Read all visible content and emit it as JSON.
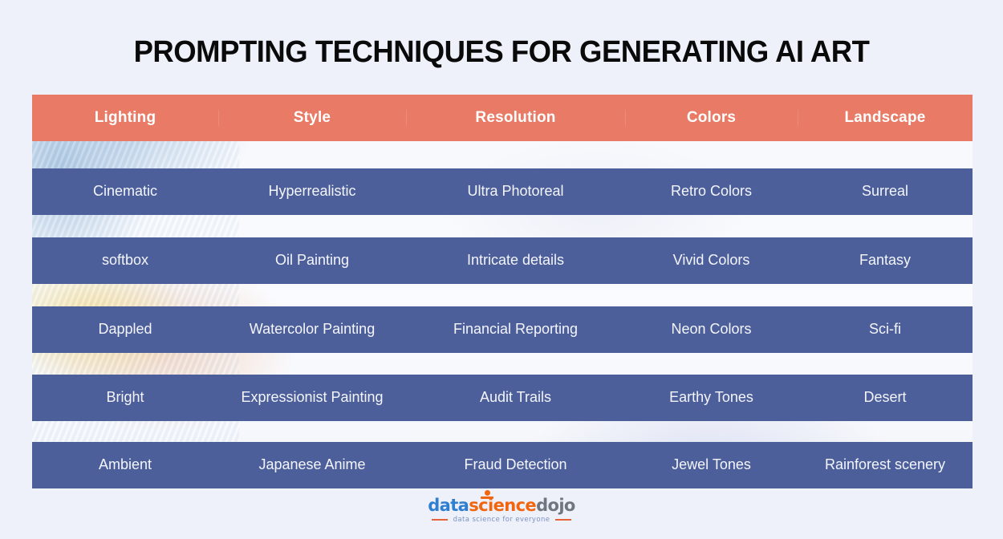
{
  "page": {
    "title": "PROMPTING TECHNIQUES FOR GENERATING AI ART",
    "background_color": "#EEF0FA"
  },
  "colors": {
    "header_background": "#E87A66",
    "row_background": "#4C5F9B",
    "header_text": "#FFFFFF",
    "row_text": "#F4F5FA",
    "title_text": "#0A0A0A",
    "logo_blue": "#2F7FD1",
    "logo_orange": "#F2650F",
    "logo_gray": "#6F7680",
    "tagline_text": "#7D93C4"
  },
  "table": {
    "headers": [
      "Lighting",
      "Style",
      "Resolution",
      "Colors",
      "Landscape"
    ],
    "rows": [
      [
        "Cinematic",
        "Hyperrealistic",
        "Ultra Photoreal",
        "Retro Colors",
        "Surreal"
      ],
      [
        "softbox",
        "Oil Painting",
        "Intricate details",
        "Vivid Colors",
        "Fantasy"
      ],
      [
        "Dappled",
        "Watercolor Painting",
        "Financial Reporting",
        "Neon Colors",
        "Sci-fi"
      ],
      [
        "Bright",
        "Expressionist Painting",
        "Audit Trails",
        "Earthy Tones",
        "Desert"
      ],
      [
        "Ambient",
        "Japanese Anime",
        "Fraud Detection",
        "Jewel Tones",
        "Rainforest scenery"
      ]
    ]
  },
  "logo": {
    "word_1": "data",
    "word_2": "science",
    "word_3": "dojo",
    "tagline": "data science for everyone"
  }
}
